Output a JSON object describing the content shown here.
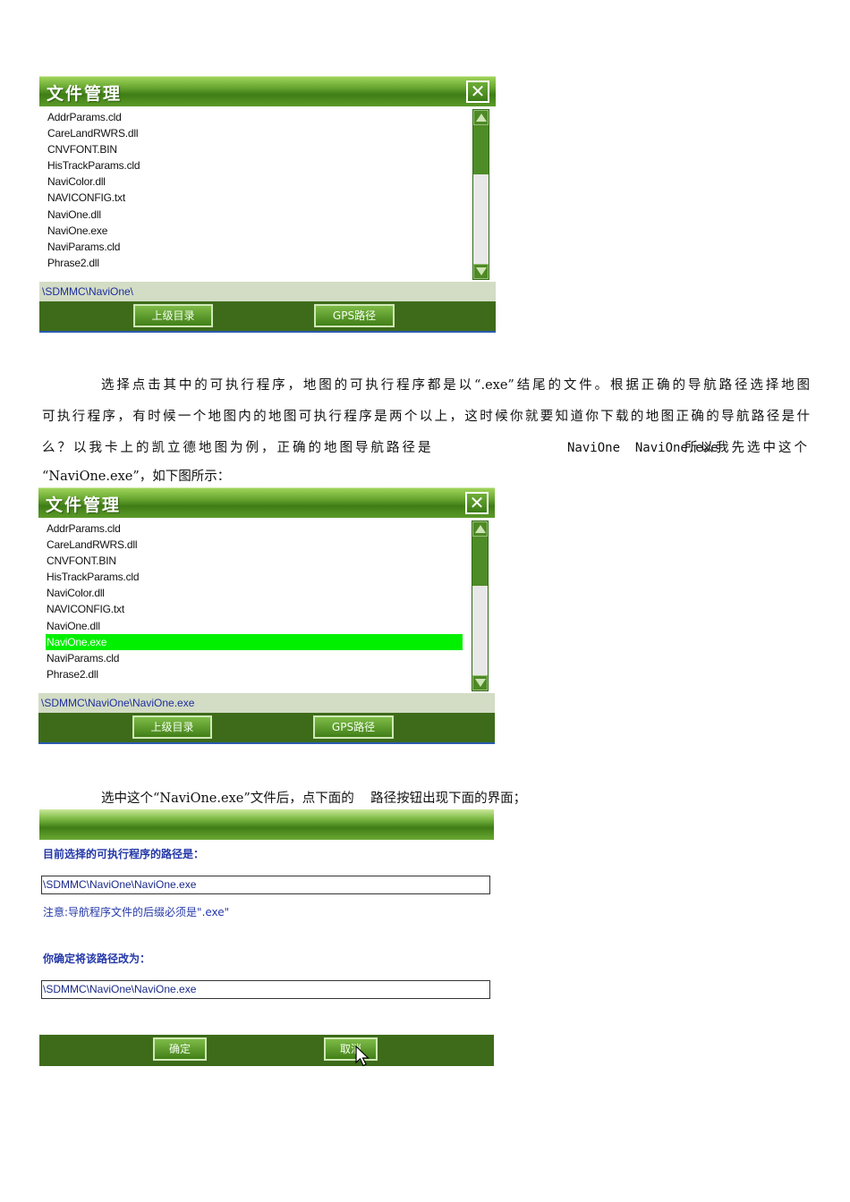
{
  "panel1": {
    "title": "文件管理",
    "close_glyph": "✕",
    "files": [
      "AddrParams.cld",
      "CareLandRWRS.dll",
      "CNVFONT.BIN",
      "HisTrackParams.cld",
      "NaviColor.dll",
      "NAVICONFIG.txt",
      "NaviOne.dll",
      "NaviOne.exe",
      "NaviParams.cld",
      "Phrase2.dll"
    ],
    "path": "\\SDMMC\\NaviOne\\",
    "btn_parent": "上级目录",
    "btn_gps": "GPS路径"
  },
  "text1": {
    "line1": "选择点击其中的可执行程序，地图的可执行程序都是以“.exe”结尾的文件。根据正确的导航路径选择地图",
    "line2": "可执行程序，有时候一个地图内的地图可执行程序是两个以上，这时候你就要知道你下载的地图正确的导航路径是什",
    "line3a": "么？以我卡上的凯立德地图为例，正确的地图导航路径是",
    "line3b": "NaviOne  NaviOne.exe",
    "line3c": "所以我先选中这个",
    "line4": "“NaviOne.exe”，如下图所示："
  },
  "panel2": {
    "title": "文件管理",
    "close_glyph": "✕",
    "files": [
      "AddrParams.cld",
      "CareLandRWRS.dll",
      "CNVFONT.BIN",
      "HisTrackParams.cld",
      "NaviColor.dll",
      "NAVICONFIG.txt",
      "NaviOne.dll",
      "NaviOne.exe",
      "NaviParams.cld",
      "Phrase2.dll"
    ],
    "selected_index": 7,
    "path": "\\SDMMC\\NaviOne\\NaviOne.exe",
    "btn_parent": "上级目录",
    "btn_gps": "GPS路径"
  },
  "text2": {
    "line1": "选中这个“NaviOne.exe”文件后，点下面的    路径按钮出现下面的界面；"
  },
  "panel3": {
    "current_label": "目前选择的可执行程序的路径是：",
    "current_path": "\\SDMMC\\NaviOne\\NaviOne.exe",
    "note": "注意:导航程序文件的后缀必须是\".exe\"",
    "confirm_label": "你确定将该路径改为：",
    "new_path": "\\SDMMC\\NaviOne\\NaviOne.exe",
    "btn_ok": "确定",
    "btn_cancel": "取消"
  },
  "colors": {
    "title_green": "#3f7d16",
    "path_blue": "#1e2fa0",
    "selection_green": "#00f000",
    "bar_dark_green": "#3d6b1a"
  }
}
